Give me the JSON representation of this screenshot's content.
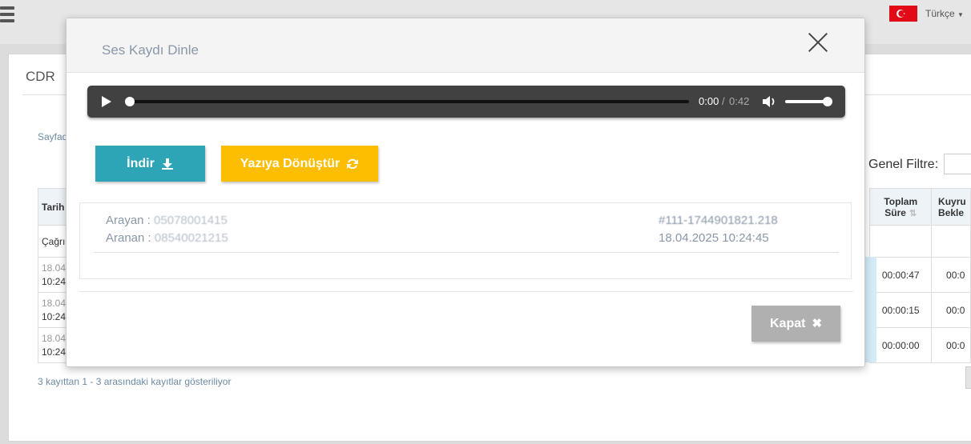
{
  "app": {
    "language": "Türkçe",
    "flag_color": "#e30a17"
  },
  "page": {
    "title": "CDR",
    "page_size_label": "Sayfad",
    "filter_label": "Genel Filtre:",
    "footer_info": "3 kayıttan 1 - 3 arasındaki kayıtlar gösteriliyor",
    "table": {
      "headers": [
        {
          "label": "Tarih",
          "visible_part": "Tarih"
        },
        {
          "label": "Toplam Süre",
          "line1": "Toplam",
          "line2": "Süre"
        },
        {
          "label": "Kuyruk Bekleme",
          "line1": "Kuyru",
          "line2": "Bekle"
        }
      ],
      "filter_row_first": "Çağrı",
      "rows": [
        {
          "date_top": "18.04",
          "time": "10:24",
          "total": "00:00:47",
          "queue": "00:0"
        },
        {
          "date_top": "18.04",
          "time": "10:24",
          "total": "00:00:15",
          "queue": "00:0"
        },
        {
          "date_top": "18.04",
          "time": "10:24",
          "total": "00:00:00",
          "queue": "00:0"
        }
      ]
    }
  },
  "modal": {
    "title": "Ses Kaydı Dinle",
    "player": {
      "current_time": "0:00",
      "separator": "/",
      "duration": "0:42",
      "progress": 0,
      "volume": 1
    },
    "buttons": {
      "download": "İndir",
      "transcribe": "Yazıya Dönüştür",
      "close": "Kapat"
    },
    "info": {
      "caller_label": "Arayan :",
      "caller_value": "05078001415",
      "callee_label": "Aranan :",
      "callee_value": "08540021215",
      "call_id": "#111-1744901821.218",
      "datetime": "18.04.2025 10:24:45"
    }
  },
  "colors": {
    "download_btn": "#2ea5b7",
    "transcribe_btn": "#fdbd00",
    "close_btn": "#b0b0b0",
    "player_bg": "#414141"
  }
}
